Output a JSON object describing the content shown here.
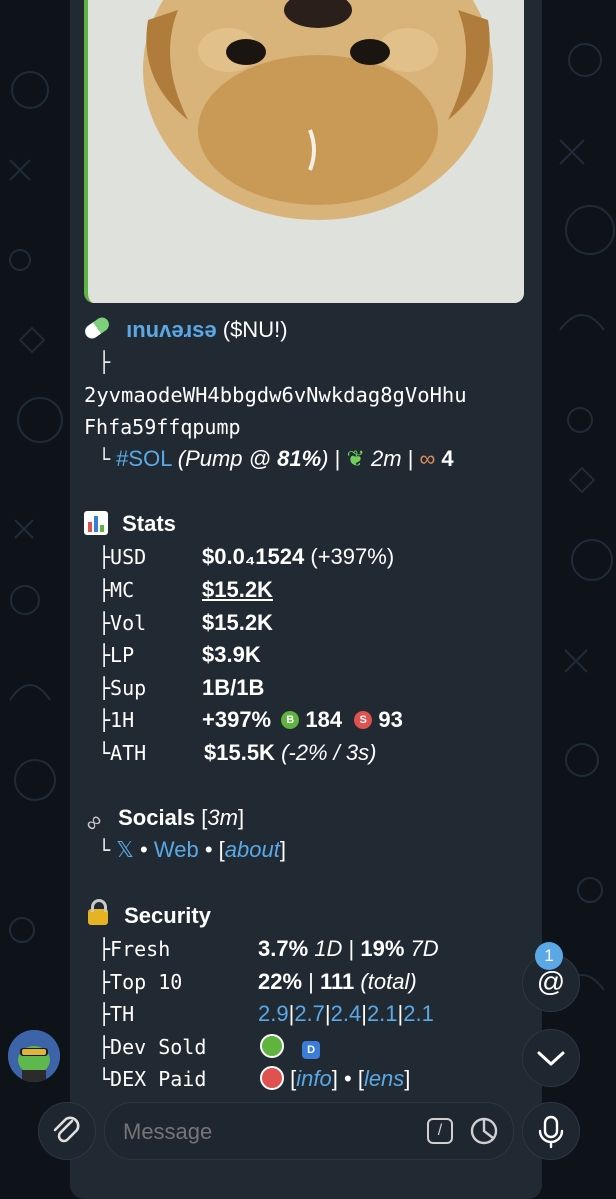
{
  "token": {
    "name": "ınuʌǝɹsǝ",
    "ticker": "($NU!)",
    "tree_top": "├",
    "address_line1": "2yvmaodeWH4bbgdw6vNwkdag8gVoHhu",
    "address_line2": "Fhfa59ffqpump",
    "tree_end": "└",
    "chain": "#SOL",
    "platform_prefix": "(Pump @ ",
    "platform_pct": "81%",
    "platform_suffix": ")",
    "sep": "|",
    "age": "2m",
    "holders_count": "4"
  },
  "stats": {
    "title": "Stats",
    "rows": [
      {
        "tree": "├",
        "label": "USD",
        "value": "$0.0₄1524",
        "extra": "(+397%)"
      },
      {
        "tree": "├",
        "label": "MC",
        "value": "$15.2K"
      },
      {
        "tree": "├",
        "label": "Vol",
        "value": "$15.2K"
      },
      {
        "tree": "├",
        "label": "LP",
        "value": "$3.9K"
      },
      {
        "tree": "├",
        "label": "Sup",
        "value": "1B/1B"
      },
      {
        "tree": "├",
        "label": "1H",
        "value": "+397%",
        "buys": "184",
        "sells": "93",
        "buy_badge": "B",
        "sell_badge": "S"
      },
      {
        "tree": "└",
        "label": "ATH",
        "value": "$15.5K",
        "extra": "(-2% / 3s)"
      }
    ]
  },
  "socials": {
    "title": "Socials",
    "age_open": "[",
    "age": "3m",
    "age_close": "]",
    "tree": "└",
    "x": "𝕏",
    "dot1": "•",
    "web": "Web",
    "dot2": "•",
    "about_open": "[",
    "about": "about",
    "about_close": "]"
  },
  "security": {
    "title": "Security",
    "fresh": {
      "tree": "├",
      "label": "Fresh",
      "v1": "3.7%",
      "p1": "1D",
      "sep": "|",
      "v2": "19%",
      "p2": "7D"
    },
    "top10": {
      "tree": "├",
      "label": "Top 10",
      "v1": "22%",
      "sep": "|",
      "v2": "111",
      "note": "(total)"
    },
    "th": {
      "tree": "├",
      "label": "TH",
      "values": [
        "2.9",
        "2.7",
        "2.4",
        "2.1",
        "2.1"
      ],
      "sep": "|"
    },
    "dev_sold": {
      "tree": "├",
      "label": "Dev Sold",
      "badge": "D"
    },
    "dex_paid": {
      "tree": "└",
      "label": "DEX Paid",
      "info": "info",
      "lens": "lens",
      "dot": "•",
      "open": "[",
      "close": "]"
    }
  },
  "composer": {
    "placeholder": "Message",
    "mention_count": "1",
    "mention_symbol": "@"
  },
  "colors": {
    "link": "#5aa9e6",
    "green": "#5fb33f",
    "red": "#e0524f",
    "bubble": "#212a33",
    "background": "#0d1319"
  }
}
